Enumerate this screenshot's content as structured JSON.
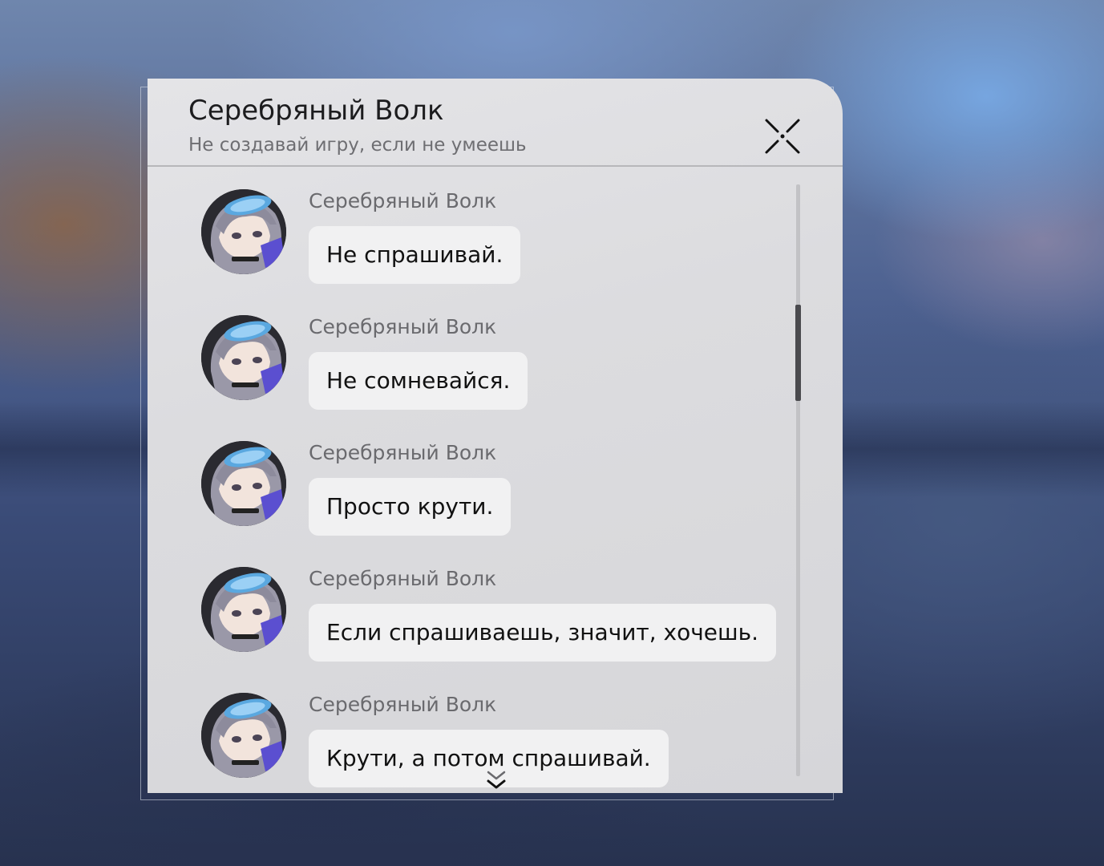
{
  "dialog": {
    "title": "Серебряный Волк",
    "subtitle": "Не создавай игру, если не умеешь",
    "close_icon": "close-x-icon"
  },
  "messages": [
    {
      "sender": "Серебряный Волк",
      "text": "Не спрашивай.",
      "avatar": "silver-wolf-avatar"
    },
    {
      "sender": "Серебряный Волк",
      "text": "Не сомневайся.",
      "avatar": "silver-wolf-avatar"
    },
    {
      "sender": "Серебряный Волк",
      "text": "Просто крути.",
      "avatar": "silver-wolf-avatar"
    },
    {
      "sender": "Серебряный Волк",
      "text": "Если спрашиваешь, значит, хочешь.",
      "avatar": "silver-wolf-avatar"
    },
    {
      "sender": "Серебряный Волк",
      "text": "Крути, а потом спрашивай.",
      "avatar": "silver-wolf-avatar"
    }
  ],
  "scroll_indicator_icon": "double-chevron-down-icon",
  "colors": {
    "panel": "#dcdcdf",
    "bubble": "#f1f1f2",
    "title_text": "#1c1c1e",
    "muted_text": "#6e6e72",
    "scroll_thumb": "#4a4a4e"
  }
}
